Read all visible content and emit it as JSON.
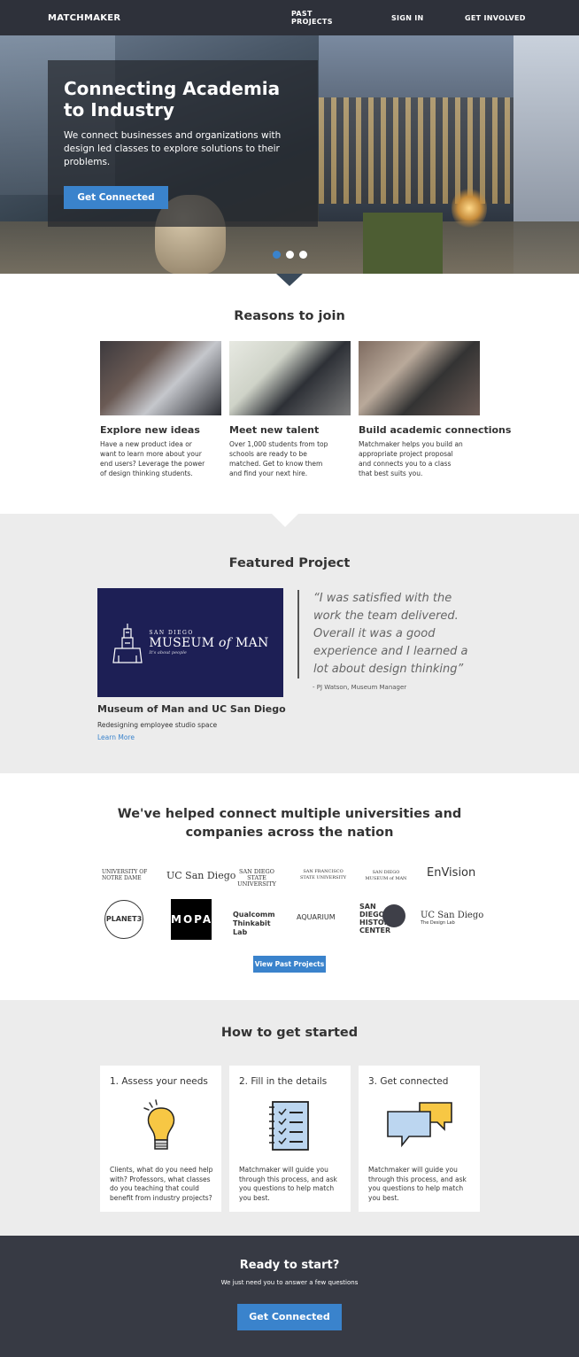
{
  "nav": {
    "brand": "MATCHMAKER",
    "links": [
      "PAST PROJECTS",
      "SIGN IN",
      "GET INVOLVED"
    ]
  },
  "hero": {
    "title": "Connecting Academia to Industry",
    "text": "We connect businesses and organizations with design led classes to explore solutions to their problems.",
    "button": "Get Connected",
    "slides": 3,
    "active_slide": 1
  },
  "reasons": {
    "title": "Reasons to join",
    "cards": [
      {
        "title": "Explore new ideas",
        "text": "Have a new product idea or want to learn more about your end users? Leverage the power of design thinking students."
      },
      {
        "title": "Meet new talent",
        "text": "Over 1,000 students from top schools are ready to be matched. Get to know them and find your next hire."
      },
      {
        "title": "Build academic connections",
        "text": "Matchmaker helps you build an appropriate project proposal and connects you to a class that best suits you."
      }
    ]
  },
  "featured": {
    "title": "Featured Project",
    "logo": {
      "line1": "SAN DIEGO",
      "line2": "MUSEUM",
      "line2b": "of",
      "line2c": "MAN",
      "tagline": "It's about people"
    },
    "project_title": "Museum of Man and UC San Diego",
    "project_sub": "Redesigning employee studio space",
    "link": "Learn More",
    "quote": "“I was satisfied with the work the team delivered. Overall it was a good experience and I learned a lot about design thinking”",
    "author": "- PJ Watson, Museum Manager"
  },
  "partners": {
    "title_line1": "We've helped connect multiple universities and",
    "title_line2": "companies across the nation",
    "logos": {
      "notre_dame": "UNIVERSITY OF NOTRE DAME",
      "ucsd": "UC San Diego",
      "sdsu": "SAN DIEGO STATE UNIVERSITY",
      "sfsu": "SAN FRANCISCO STATE UNIVERSITY",
      "museum": "SAN DIEGO MUSEUM of MAN",
      "envision": "EnVision",
      "planet3": "PLANET3",
      "mopa": "MOPA",
      "qualcomm": "Qualcomm Thinkabit Lab",
      "aquarium": "AQUARIUM",
      "sdhc": "SAN DIEGO HISTORY CENTER",
      "ucsd_design": "UC San Diego",
      "ucsd_design_sub": "The Design Lab"
    },
    "button": "View Past Projects"
  },
  "how": {
    "title": "How to get started",
    "steps": [
      {
        "title": "1. Assess your needs",
        "icon": "lightbulb-icon",
        "text": "Clients, what do you need help with? Professors, what classes do you teaching that could benefit from industry projects?"
      },
      {
        "title": "2. Fill in the details",
        "icon": "checklist-icon",
        "text": "Matchmaker will guide you through this process, and ask you questions to help match you best."
      },
      {
        "title": "3. Get connected",
        "icon": "chat-bubbles-icon",
        "text": "Matchmaker will guide you through this process, and ask you questions to help match you best."
      }
    ]
  },
  "footer": {
    "title": "Ready to start?",
    "sub": "We just need you to answer a few questions",
    "button": "Get Connected"
  },
  "colors": {
    "nav": "#2e313a",
    "accent": "#3a83cc",
    "gray_section": "#ececec",
    "footer": "#373a44",
    "museum_bg": "#1d1f55"
  }
}
